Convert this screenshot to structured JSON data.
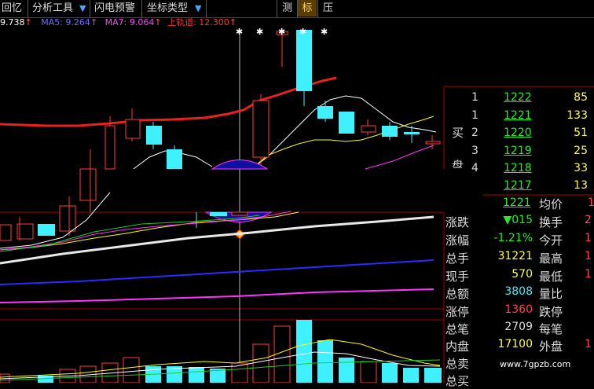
{
  "toolbar": {
    "items": [
      "回忆",
      "分析工具",
      "闪电预警",
      "坐标类型"
    ],
    "dropdown_glyph": "▼",
    "tabs": [
      "测",
      "标",
      "压"
    ],
    "active_tab": "标"
  },
  "indicator_line": {
    "first": "9.738",
    "ma5": "MA5: 9.264",
    "ma7": "MA7: 9.064",
    "upper": "上轨道: 12.300",
    "arrow": "↑"
  },
  "order_book": {
    "buy_label": "买",
    "sell_label_partial": "盘",
    "rows": [
      {
        "level": "1",
        "price": "1222",
        "vol": "85"
      },
      {
        "level": "1",
        "price": "1221",
        "vol": "133"
      },
      {
        "level": "2",
        "price": "1220",
        "vol": "51"
      },
      {
        "level": "3",
        "price": "1219",
        "vol": "25"
      },
      {
        "level": "4",
        "price": "1218",
        "vol": "33"
      },
      {
        "level": "",
        "price": "1217",
        "vol": "13"
      }
    ]
  },
  "quote": {
    "latest": {
      "value": "1221",
      "label": "均价",
      "tail": "1"
    },
    "rows": [
      {
        "label": "涨跌",
        "value": "▼015",
        "label2": "换手",
        "tail": "2"
      },
      {
        "label": "涨幅",
        "value": "-1.21%",
        "label2": "今开",
        "tail": "1"
      },
      {
        "label": "总手",
        "value": "31221",
        "label2": "最高",
        "tail": "1"
      },
      {
        "label": "现手",
        "value": "570",
        "label2": "最低",
        "tail": "1"
      },
      {
        "label": "总额",
        "value": "3808",
        "label2": "量比",
        "tail": ""
      },
      {
        "label": "涨停",
        "value": "1360",
        "label2": "跌停",
        "tail": ""
      },
      {
        "label": "总笔",
        "value": "2709",
        "label2": "每笔",
        "tail": ""
      },
      {
        "label": "内盘",
        "value": "17100",
        "label2": "外盘",
        "tail": "1"
      },
      {
        "label": "总卖",
        "value": "",
        "label2": "",
        "tail": ""
      },
      {
        "label": "总买",
        "value": "",
        "label2": "",
        "tail": ""
      }
    ]
  },
  "watermark": "www.7gpzb.com",
  "colors": {
    "up": "#ff3b3b",
    "down": "#3ff0ff",
    "bg": "#000000",
    "grid": "#aa0000",
    "yellow": "#ffff00"
  }
}
